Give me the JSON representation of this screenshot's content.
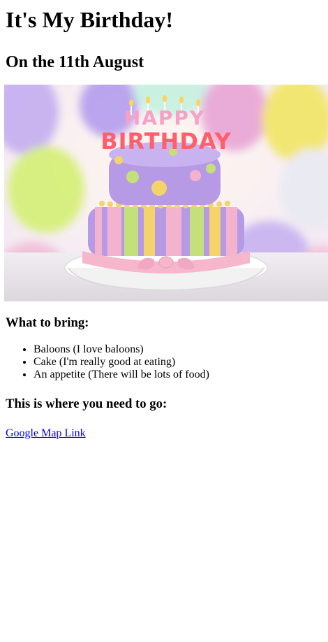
{
  "page": {
    "title": "It's My Birthday!",
    "subtitle": "On the 11th August"
  },
  "hero_image": {
    "alt": "Birthday cake",
    "cake_text": "HAPPY BIRTHDAY",
    "colors": {
      "frosting_purple": "#b79ae6",
      "stripe_pink": "#f3b3cf",
      "stripe_green": "#c3e07a",
      "stripe_yellow": "#f3d36a",
      "ribbon": "#f6b6cc"
    }
  },
  "bring": {
    "heading": "What to bring:",
    "items": [
      "Baloons (I love baloons)",
      "Cake (I'm really good at eating)",
      "An appetite (There will be lots of food)"
    ]
  },
  "directions": {
    "heading": "This is where you need to go:",
    "link_text": "Google Map Link"
  }
}
